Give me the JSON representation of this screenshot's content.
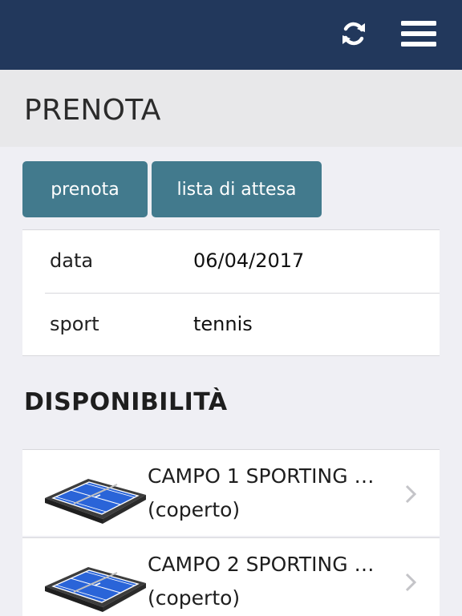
{
  "header": {
    "refresh_icon": "refresh-icon",
    "menu_icon": "hamburger-menu-icon",
    "background": "#22385c"
  },
  "page": {
    "title": "PRENOTA"
  },
  "tabs": [
    {
      "label": "prenota"
    },
    {
      "label": "lista di attesa"
    }
  ],
  "form": {
    "rows": [
      {
        "label": "data",
        "value": "06/04/2017"
      },
      {
        "label": "sport",
        "value": "tennis"
      }
    ]
  },
  "availability": {
    "title": "DISPONIBILITÀ",
    "courts": [
      {
        "name": "CAMPO 1 SPORTING …",
        "type": "(coperto)",
        "icon": "tennis-court-icon"
      },
      {
        "name": "CAMPO 2 SPORTING …",
        "type": "(coperto)",
        "icon": "tennis-court-icon"
      }
    ]
  },
  "colors": {
    "accent": "#427a8d",
    "court_blue": "#2a64d8"
  }
}
